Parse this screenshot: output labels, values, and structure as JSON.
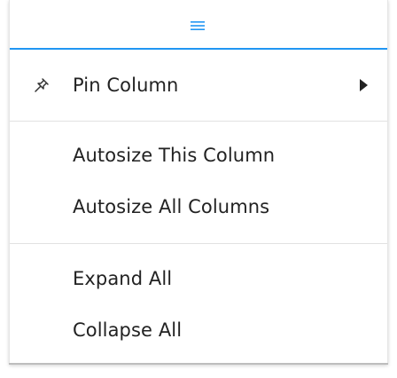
{
  "tab": {
    "icon": "menu-icon",
    "accent_color": "#2196f3"
  },
  "menu": {
    "pin_column": {
      "label": "Pin Column",
      "icon": "pin-icon",
      "submenu": true
    },
    "autosize_this": {
      "label": "Autosize This Column"
    },
    "autosize_all": {
      "label": "Autosize All Columns"
    },
    "expand_all": {
      "label": "Expand All"
    },
    "collapse_all": {
      "label": "Collapse All"
    }
  }
}
